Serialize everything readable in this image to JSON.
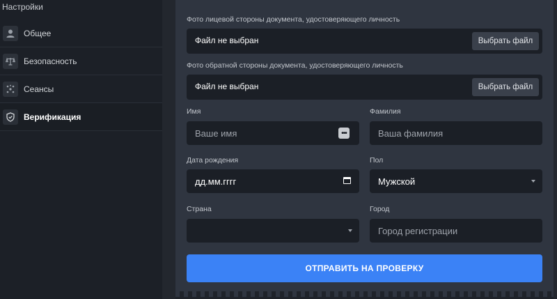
{
  "sidebar": {
    "title": "Настройки",
    "items": [
      {
        "label": "Общее",
        "icon": "user-icon"
      },
      {
        "label": "Безопасность",
        "icon": "scales-icon"
      },
      {
        "label": "Сеансы",
        "icon": "sessions-icon"
      },
      {
        "label": "Верификация",
        "icon": "shield-icon",
        "active": true
      }
    ]
  },
  "form": {
    "front_doc": {
      "label": "Фото лицевой стороны документа, удостоверяющего личность",
      "status": "Файл не выбран",
      "button": "Выбрать файл"
    },
    "back_doc": {
      "label": "Фото обратной стороны документа, удостоверяющего личность",
      "status": "Файл не выбран",
      "button": "Выбрать файл"
    },
    "first_name": {
      "label": "Имя",
      "placeholder": "Ваше имя"
    },
    "last_name": {
      "label": "Фамилия",
      "placeholder": "Ваша фамилия"
    },
    "birth_date": {
      "label": "Дата рождения",
      "value": "дд.мм.гггг"
    },
    "gender": {
      "label": "Пол",
      "value": "Мужской"
    },
    "country": {
      "label": "Страна",
      "value": ""
    },
    "city": {
      "label": "Город",
      "placeholder": "Город регистрации"
    },
    "submit": "ОТПРАВИТЬ НА ПРОВЕРКУ"
  },
  "colors": {
    "accent": "#3b82f6",
    "panel": "#2f3540",
    "input_bg": "#1b1f26"
  }
}
